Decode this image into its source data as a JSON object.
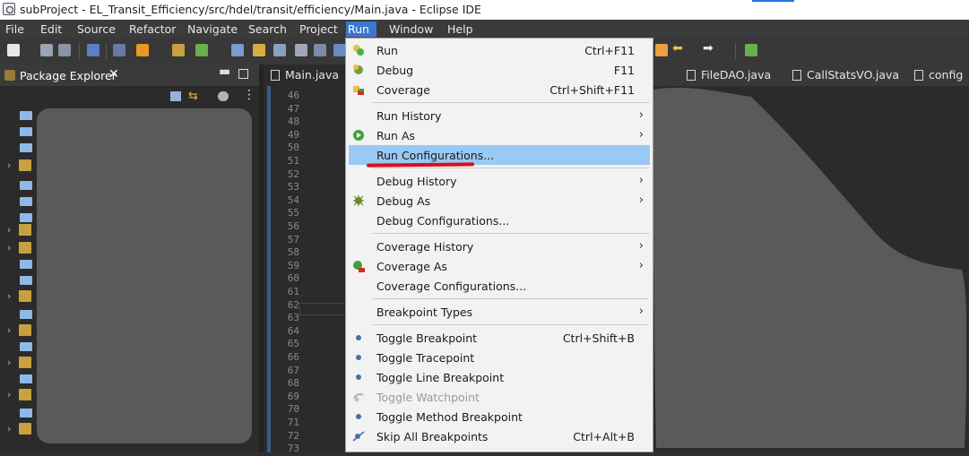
{
  "window": {
    "title": "subProject - EL_Transit_Efficiency/src/hdel/transit/efficiency/Main.java - Eclipse IDE"
  },
  "menubar": [
    {
      "label": "File"
    },
    {
      "label": "Edit"
    },
    {
      "label": "Source"
    },
    {
      "label": "Refactor"
    },
    {
      "label": "Navigate"
    },
    {
      "label": "Search"
    },
    {
      "label": "Project"
    },
    {
      "label": "Run",
      "active": true
    },
    {
      "label": "Window"
    },
    {
      "label": "Help"
    }
  ],
  "package_explorer": {
    "title": "Package Explorer"
  },
  "editor": {
    "tabs": [
      {
        "label": "Main.java",
        "active": true
      },
      {
        "label": "FileDAO.java"
      },
      {
        "label": "CallStatsVO.java"
      },
      {
        "label": "config"
      }
    ],
    "line_numbers": [
      "46",
      "47",
      "48",
      "49",
      "50",
      "51",
      "52",
      "53",
      "54",
      "55",
      "56",
      "57",
      "58",
      "59",
      "60",
      "61",
      "62",
      "63",
      "64",
      "65",
      "66",
      "67",
      "68",
      "69",
      "70",
      "71",
      "72",
      "73"
    ]
  },
  "run_menu": {
    "items": [
      {
        "label": "Run",
        "shortcut": "Ctrl+F11",
        "icon": "run-icon"
      },
      {
        "label": "Debug",
        "shortcut": "F11",
        "icon": "debug-icon"
      },
      {
        "label": "Coverage",
        "shortcut": "Ctrl+Shift+F11",
        "icon": "coverage-icon"
      },
      {
        "label": "Run History",
        "submenu": true
      },
      {
        "label": "Run As",
        "submenu": true,
        "icon": "run-as-icon"
      },
      {
        "label": "Run Configurations...",
        "highlighted": true
      },
      {
        "label": "Debug History",
        "submenu": true
      },
      {
        "label": "Debug As",
        "submenu": true,
        "icon": "debug-as-icon"
      },
      {
        "label": "Debug Configurations..."
      },
      {
        "label": "Coverage History",
        "submenu": true
      },
      {
        "label": "Coverage As",
        "submenu": true,
        "icon": "coverage-as-icon"
      },
      {
        "label": "Coverage Configurations..."
      },
      {
        "label": "Breakpoint Types",
        "submenu": true
      },
      {
        "label": "Toggle Breakpoint",
        "shortcut": "Ctrl+Shift+B",
        "icon": "breakpoint-dot-icon"
      },
      {
        "label": "Toggle Tracepoint",
        "icon": "tracepoint-dot-icon"
      },
      {
        "label": "Toggle Line Breakpoint",
        "icon": "line-breakpoint-dot-icon"
      },
      {
        "label": "Toggle Watchpoint",
        "disabled": true,
        "icon": "watchpoint-icon"
      },
      {
        "label": "Toggle Method Breakpoint",
        "icon": "method-breakpoint-dot-icon"
      },
      {
        "label": "Skip All Breakpoints",
        "shortcut": "Ctrl+Alt+B",
        "icon": "skip-breakpoints-icon"
      }
    ]
  }
}
